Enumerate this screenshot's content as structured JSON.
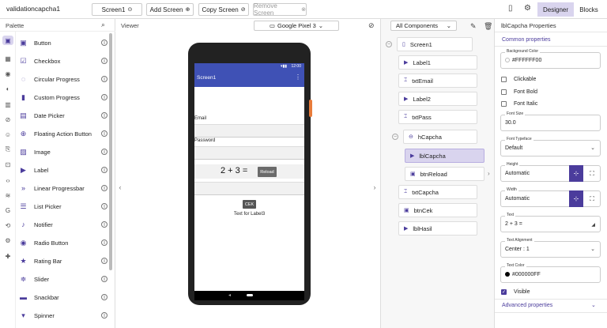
{
  "topbar": {
    "project_name": "validationcapcha1",
    "screen_button": "Screen1",
    "add_screen": "Add Screen",
    "copy_screen": "Copy Screen",
    "remove_screen": "Remove Screen",
    "designer": "Designer",
    "blocks": "Blocks"
  },
  "palette": {
    "title": "Palette",
    "components": [
      {
        "label": "Button",
        "icon": "button-icon"
      },
      {
        "label": "Checkbox",
        "icon": "checkbox-icon"
      },
      {
        "label": "Circular Progress",
        "icon": "circular-progress-icon"
      },
      {
        "label": "Custom Progress",
        "icon": "custom-progress-icon"
      },
      {
        "label": "Date Picker",
        "icon": "date-picker-icon"
      },
      {
        "label": "Floating Action Button",
        "icon": "fab-icon"
      },
      {
        "label": "Image",
        "icon": "image-icon"
      },
      {
        "label": "Label",
        "icon": "label-icon"
      },
      {
        "label": "Linear Progressbar",
        "icon": "linear-progress-icon"
      },
      {
        "label": "List Picker",
        "icon": "list-picker-icon"
      },
      {
        "label": "Notifier",
        "icon": "notifier-icon"
      },
      {
        "label": "Radio Button",
        "icon": "radio-button-icon"
      },
      {
        "label": "Rating Bar",
        "icon": "rating-bar-icon"
      },
      {
        "label": "Slider",
        "icon": "slider-icon"
      },
      {
        "label": "Snackbar",
        "icon": "snackbar-icon"
      },
      {
        "label": "Spinner",
        "icon": "spinner-icon"
      }
    ]
  },
  "viewer": {
    "title": "Viewer",
    "device": "Google Pixel 3",
    "status_time": "12:00",
    "screen_title": "Screen1",
    "email_label": "Email",
    "password_label": "Password",
    "captcha_text": "2 + 3 =",
    "reload_button": "Reload",
    "cek_button": "CEK",
    "label3_text": "Text for Label3"
  },
  "tree": {
    "selector": "All Components",
    "nodes": [
      {
        "label": "Screen1",
        "icon": "phone-icon"
      },
      {
        "label": "Label1",
        "icon": "label-icon"
      },
      {
        "label": "txtEmail",
        "icon": "textbox-icon"
      },
      {
        "label": "Label2",
        "icon": "label-icon"
      },
      {
        "label": "txtPass",
        "icon": "textbox-icon"
      },
      {
        "label": "hCapcha",
        "icon": "arrangement-icon"
      },
      {
        "label": "lblCapcha",
        "icon": "label-icon"
      },
      {
        "label": "btnReload",
        "icon": "button-icon"
      },
      {
        "label": "txtCapcha",
        "icon": "textbox-icon"
      },
      {
        "label": "btnCek",
        "icon": "button-icon"
      },
      {
        "label": "lblHasil",
        "icon": "label-icon"
      }
    ]
  },
  "props": {
    "title": "lblCapcha Properties",
    "common_header": "Common properties",
    "background_color_label": "Background Color",
    "background_color_value": "#FFFFFF00",
    "clickable": "Clickable",
    "font_bold": "Font Bold",
    "font_italic": "Font Italic",
    "font_size_label": "Font Size",
    "font_size_value": "30.0",
    "font_typeface_label": "Font Typeface",
    "font_typeface_value": "Default",
    "height_label": "Height",
    "height_value": "Automatic",
    "width_label": "Width",
    "width_value": "Automatic",
    "text_label": "Text",
    "text_value": "2 + 3 =",
    "text_alignment_label": "Text Alignment",
    "text_alignment_value": "Center : 1",
    "text_color_label": "Text Color",
    "text_color_value": "#000000FF",
    "visible": "Visible",
    "advanced_header": "Advanced properties"
  },
  "colors": {
    "accent": "#4b3c9c",
    "appbar": "#3f51b5",
    "selected": "#d9d4ee"
  }
}
